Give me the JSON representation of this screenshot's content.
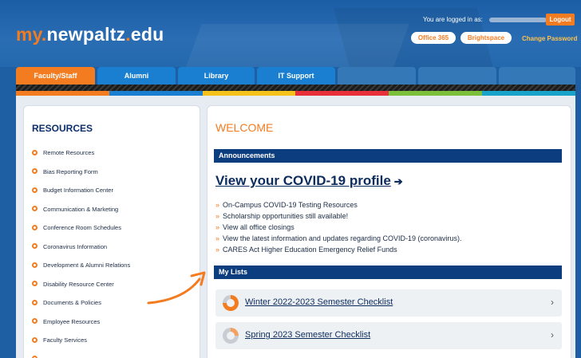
{
  "header": {
    "logo_prefix": "my.",
    "logo_main": "newpaltz",
    "logo_dot": ".",
    "logo_suffix": "edu",
    "logged_in_label": "You are logged in as:",
    "logout": "Logout",
    "office365": "Office 365",
    "brightspace": "Brightspace",
    "change_password": "Change Password"
  },
  "tabs": [
    "Faculty/Staff",
    "Alumni",
    "Library",
    "IT Support"
  ],
  "colors": {
    "orange": "#f47c20",
    "navy": "#0c3d7e",
    "colorbar": [
      "#f47c20",
      "#1a7fd0",
      "#f5c21b",
      "#e8303a",
      "#7bbf3a",
      "#1aa3c9"
    ]
  },
  "resources": {
    "title": "RESOURCES",
    "items": [
      "Remote Resources",
      "Bias Reporting Form",
      "Budget Information Center",
      "Communication & Marketing",
      "Conference Room Schedules",
      "Coronavirus Information",
      "Development & Alumni Relations",
      "Disability Resource Center",
      "Documents & Policies",
      "Employee Resources",
      "Faculty Services"
    ]
  },
  "main": {
    "welcome": "WELCOME",
    "announcements_label": "Announcements",
    "covid_link": "View your COVID-19 profile",
    "announcements": [
      "On-Campus COVID-19 Testing Resources",
      "Scholarship opportunities still available!",
      "View all office closings",
      "View the latest information and updates regarding COVID-19 (coronavirus).",
      "CARES Act Higher Education Emergency Relief Funds"
    ],
    "my_lists_label": "My Lists",
    "checklists": [
      {
        "title": "Winter 2022-2023 Semester Checklist",
        "progress": 0.75
      },
      {
        "title": "Spring 2023 Semester Checklist",
        "progress": 0.25
      }
    ]
  }
}
